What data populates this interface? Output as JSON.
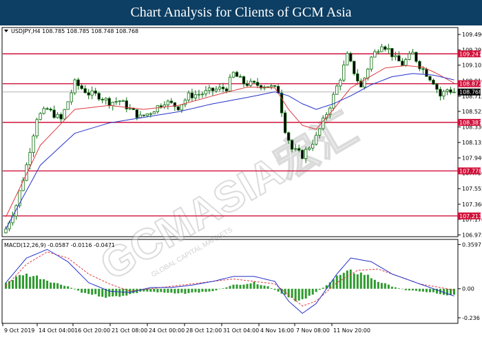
{
  "banner": {
    "title": "Chart Analysis for Clients of GCM Asia"
  },
  "watermark": {
    "brand": "GCMASIA宏汇",
    "tagline": "GLOBAL CAPITAL MARKETS"
  },
  "colors": {
    "banner_bg": "#0d3e63",
    "candle": "#0b6b0b",
    "ma_fast": "#e0383e",
    "ma_slow": "#2430c8",
    "level_line": "#d0103a",
    "macd_hist": "#2e9a2e",
    "macd_signal": "#e0383e",
    "macd_line": "#2430c8"
  },
  "chart_data": [
    {
      "type": "candlestick",
      "title": "USDJPY,H4 108.785 108.785 108.748 108.768",
      "symbol_icon": "triangle-down-icon",
      "ylim": [
        106.97,
        109.56
      ],
      "y_ticks": [
        "109.490",
        "109.295",
        "109.105",
        "108.910",
        "108.715",
        "108.525",
        "108.330",
        "108.135",
        "107.940",
        "107.750",
        "107.555",
        "107.360",
        "107.170",
        "106.975"
      ],
      "x_ticks": [
        "9 Oct 2019",
        "14 Oct 04:00",
        "16 Oct 20:00",
        "21 Oct 08:00",
        "24 Oct 00:00",
        "28 Oct 12:00",
        "31 Oct 04:00",
        "4 Nov 16:00",
        "7 Nov 08:00",
        "11 Nov 20:00"
      ],
      "levels": [
        {
          "value": 109.247,
          "label": "109.247"
        },
        {
          "value": 108.872,
          "label": "108.872"
        },
        {
          "value": 108.387,
          "label": "108.387"
        },
        {
          "value": 107.778,
          "label": "107.778"
        },
        {
          "value": 107.213,
          "label": "107.213"
        }
      ],
      "current_price": {
        "value": 108.768,
        "label": "108.768"
      },
      "candle_count": 131,
      "close_path": [
        [
          0,
          107.05
        ],
        [
          3,
          107.35
        ],
        [
          6,
          107.85
        ],
        [
          9,
          108.45
        ],
        [
          12,
          108.55
        ],
        [
          16,
          108.42
        ],
        [
          20,
          108.88
        ],
        [
          24,
          108.75
        ],
        [
          27,
          108.72
        ],
        [
          30,
          108.64
        ],
        [
          33,
          108.66
        ],
        [
          36,
          108.55
        ],
        [
          39,
          108.45
        ],
        [
          42,
          108.52
        ],
        [
          46,
          108.65
        ],
        [
          50,
          108.58
        ],
        [
          53,
          108.72
        ],
        [
          57,
          108.75
        ],
        [
          61,
          108.8
        ],
        [
          64,
          108.82
        ],
        [
          66,
          109.0
        ],
        [
          69,
          108.88
        ],
        [
          72,
          108.86
        ],
        [
          76,
          108.85
        ],
        [
          79,
          108.78
        ],
        [
          81,
          108.3
        ],
        [
          83,
          108.05
        ],
        [
          86,
          107.97
        ],
        [
          90,
          108.2
        ],
        [
          94,
          108.6
        ],
        [
          97,
          108.95
        ],
        [
          99,
          109.22
        ],
        [
          101,
          109.02
        ],
        [
          103,
          108.82
        ],
        [
          106,
          109.2
        ],
        [
          109,
          109.38
        ],
        [
          111,
          109.3
        ],
        [
          113,
          109.18
        ],
        [
          115,
          109.12
        ],
        [
          118,
          109.25
        ],
        [
          120,
          109.1
        ],
        [
          122,
          109.0
        ],
        [
          124,
          108.9
        ],
        [
          126,
          108.72
        ],
        [
          128,
          108.8
        ],
        [
          130,
          108.77
        ]
      ],
      "ma_fast_path": [
        [
          0,
          107.2
        ],
        [
          10,
          108.1
        ],
        [
          20,
          108.55
        ],
        [
          30,
          108.6
        ],
        [
          40,
          108.55
        ],
        [
          50,
          108.6
        ],
        [
          60,
          108.72
        ],
        [
          70,
          108.83
        ],
        [
          78,
          108.82
        ],
        [
          82,
          108.55
        ],
        [
          86,
          108.35
        ],
        [
          90,
          108.3
        ],
        [
          95,
          108.55
        ],
        [
          100,
          108.82
        ],
        [
          106,
          108.97
        ],
        [
          110,
          109.07
        ],
        [
          116,
          109.1
        ],
        [
          121,
          109.08
        ],
        [
          125,
          109.0
        ],
        [
          130,
          108.88
        ]
      ],
      "ma_slow_path": [
        [
          0,
          107.05
        ],
        [
          10,
          107.85
        ],
        [
          20,
          108.25
        ],
        [
          30,
          108.38
        ],
        [
          40,
          108.45
        ],
        [
          50,
          108.52
        ],
        [
          60,
          108.62
        ],
        [
          70,
          108.7
        ],
        [
          78,
          108.77
        ],
        [
          82,
          108.72
        ],
        [
          86,
          108.62
        ],
        [
          90,
          108.55
        ],
        [
          95,
          108.62
        ],
        [
          100,
          108.72
        ],
        [
          106,
          108.86
        ],
        [
          112,
          108.96
        ],
        [
          118,
          109.0
        ],
        [
          124,
          108.98
        ],
        [
          130,
          108.92
        ]
      ]
    },
    {
      "type": "macd",
      "title": "MACD(12,26,9) -0.0587 -0.0116 -0.0471",
      "ylim": [
        -0.27,
        0.39
      ],
      "y_ticks": [
        "0.3597",
        "0.00",
        "-0.236"
      ],
      "histogram_path": [
        [
          0,
          0.05
        ],
        [
          5,
          0.12
        ],
        [
          9,
          0.1
        ],
        [
          14,
          0.05
        ],
        [
          18,
          0.02
        ],
        [
          22,
          -0.03
        ],
        [
          26,
          -0.05
        ],
        [
          30,
          -0.07
        ],
        [
          35,
          -0.05
        ],
        [
          40,
          -0.02
        ],
        [
          45,
          -0.03
        ],
        [
          50,
          -0.04
        ],
        [
          55,
          -0.03
        ],
        [
          60,
          -0.02
        ],
        [
          66,
          0.03
        ],
        [
          72,
          0.05
        ],
        [
          76,
          0.02
        ],
        [
          80,
          -0.04
        ],
        [
          84,
          -0.1
        ],
        [
          88,
          -0.06
        ],
        [
          92,
          0.01
        ],
        [
          96,
          0.1
        ],
        [
          100,
          0.14
        ],
        [
          104,
          0.12
        ],
        [
          108,
          0.06
        ],
        [
          112,
          0.02
        ],
        [
          116,
          -0.01
        ],
        [
          120,
          -0.02
        ],
        [
          124,
          -0.03
        ],
        [
          128,
          -0.05
        ],
        [
          130,
          -0.047
        ]
      ],
      "signal_path": [
        [
          0,
          0.02
        ],
        [
          6,
          0.2
        ],
        [
          12,
          0.3
        ],
        [
          18,
          0.25
        ],
        [
          24,
          0.12
        ],
        [
          30,
          0.04
        ],
        [
          36,
          -0.02
        ],
        [
          42,
          0.0
        ],
        [
          48,
          0.02
        ],
        [
          54,
          0.04
        ],
        [
          60,
          0.06
        ],
        [
          66,
          0.08
        ],
        [
          72,
          0.06
        ],
        [
          78,
          0.04
        ],
        [
          82,
          -0.05
        ],
        [
          86,
          -0.14
        ],
        [
          90,
          -0.1
        ],
        [
          96,
          0.05
        ],
        [
          102,
          0.15
        ],
        [
          108,
          0.16
        ],
        [
          114,
          0.1
        ],
        [
          120,
          0.04
        ],
        [
          126,
          0.01
        ],
        [
          130,
          -0.012
        ]
      ],
      "macd_path": [
        [
          0,
          0.05
        ],
        [
          6,
          0.25
        ],
        [
          12,
          0.32
        ],
        [
          18,
          0.22
        ],
        [
          24,
          0.05
        ],
        [
          30,
          -0.02
        ],
        [
          36,
          -0.03
        ],
        [
          42,
          0.01
        ],
        [
          48,
          0.01
        ],
        [
          54,
          0.03
        ],
        [
          60,
          0.06
        ],
        [
          66,
          0.1
        ],
        [
          72,
          0.1
        ],
        [
          78,
          0.06
        ],
        [
          82,
          -0.1
        ],
        [
          86,
          -0.2
        ],
        [
          90,
          -0.12
        ],
        [
          96,
          0.12
        ],
        [
          100,
          0.25
        ],
        [
          106,
          0.22
        ],
        [
          112,
          0.12
        ],
        [
          118,
          0.06
        ],
        [
          124,
          0.0
        ],
        [
          130,
          -0.059
        ]
      ]
    }
  ]
}
